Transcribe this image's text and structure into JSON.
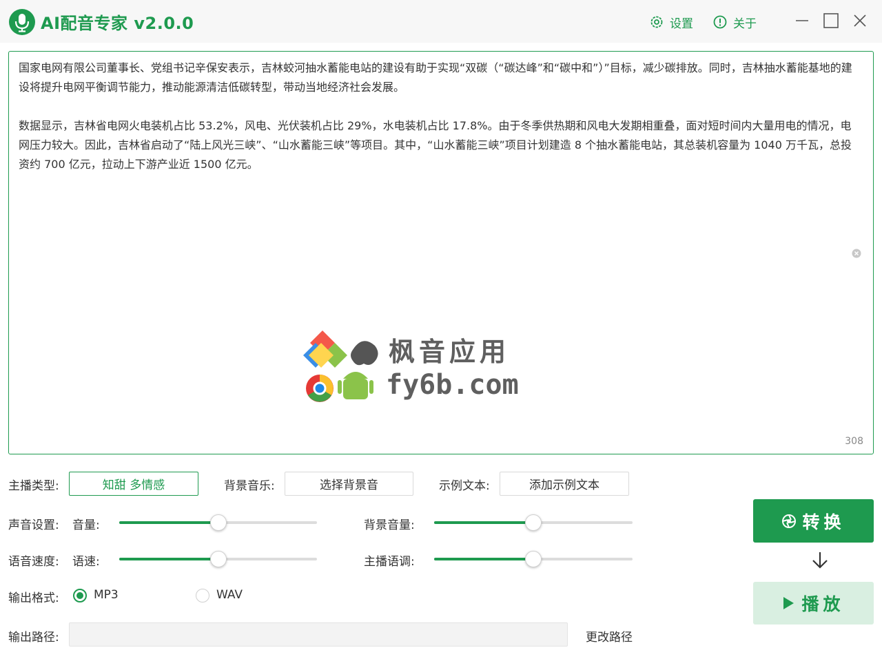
{
  "app": {
    "title": "AI配音专家 v2.0.0",
    "settings_label": "设置",
    "about_label": "关于",
    "brand_color": "#1e9a4f"
  },
  "editor": {
    "paragraphs": [
      "国家电网有限公司董事长、党组书记辛保安表示，吉林蛟河抽水蓄能电站的建设有助于实现“双碳（“碳达峰”和“碳中和”）”目标，减少碳排放。同时，吉林抽水蓄能基地的建设将提升电网平衡调节能力，推动能源清洁低碳转型，带动当地经济社会发展。",
      "数据显示，吉林省电网火电装机占比 53.2%，风电、光伏装机占比 29%，水电装机占比 17.8%。由于冬季供热期和风电大发期相重叠，面对短时间内大量用电的情况，电网压力较大。因此，吉林省启动了“陆上风光三峡”、“山水蓄能三峡”等项目。其中，“山水蓄能三峡”项目计划建造 8 个抽水蓄能电站，其总装机容量为 1040 万千瓦，总投资约 700 亿元，拉动上下游产业近 1500 亿元。"
    ],
    "char_count": "308"
  },
  "watermark": {
    "line1": "枫音应用",
    "line2": "fy6b.com"
  },
  "controls": {
    "anchor_type_label": "主播类型:",
    "anchor_type_value": "知甜 多情感",
    "bgm_label": "背景音乐:",
    "bgm_button": "选择背景音",
    "sample_label": "示例文本:",
    "sample_button": "添加示例文本",
    "sound_settings_label": "声音设置:",
    "volume_label": "音量:",
    "bg_volume_label": "背景音量:",
    "speech_speed_row_label": "语音速度:",
    "speed_label": "语速:",
    "pitch_label": "主播语调:",
    "sliders": {
      "volume": 0.5,
      "bg_volume": 0.5,
      "speed": 0.5,
      "pitch": 0.5
    },
    "output_format_label": "输出格式:",
    "format_options": [
      "MP3",
      "WAV"
    ],
    "format_selected": "MP3",
    "output_path_label": "输出路径:",
    "output_path_value": "",
    "change_path_label": "更改路径"
  },
  "actions": {
    "convert_label": "转换",
    "play_label": "播放"
  },
  "icons": {
    "logo": "microphone-icon",
    "settings": "gear-icon",
    "about": "info-icon",
    "minimize": "minimize-icon",
    "maximize": "maximize-icon",
    "close": "close-icon",
    "clear": "clear-circle-icon",
    "convert": "aperture-icon",
    "arrow": "arrow-down-icon",
    "play": "play-icon"
  }
}
